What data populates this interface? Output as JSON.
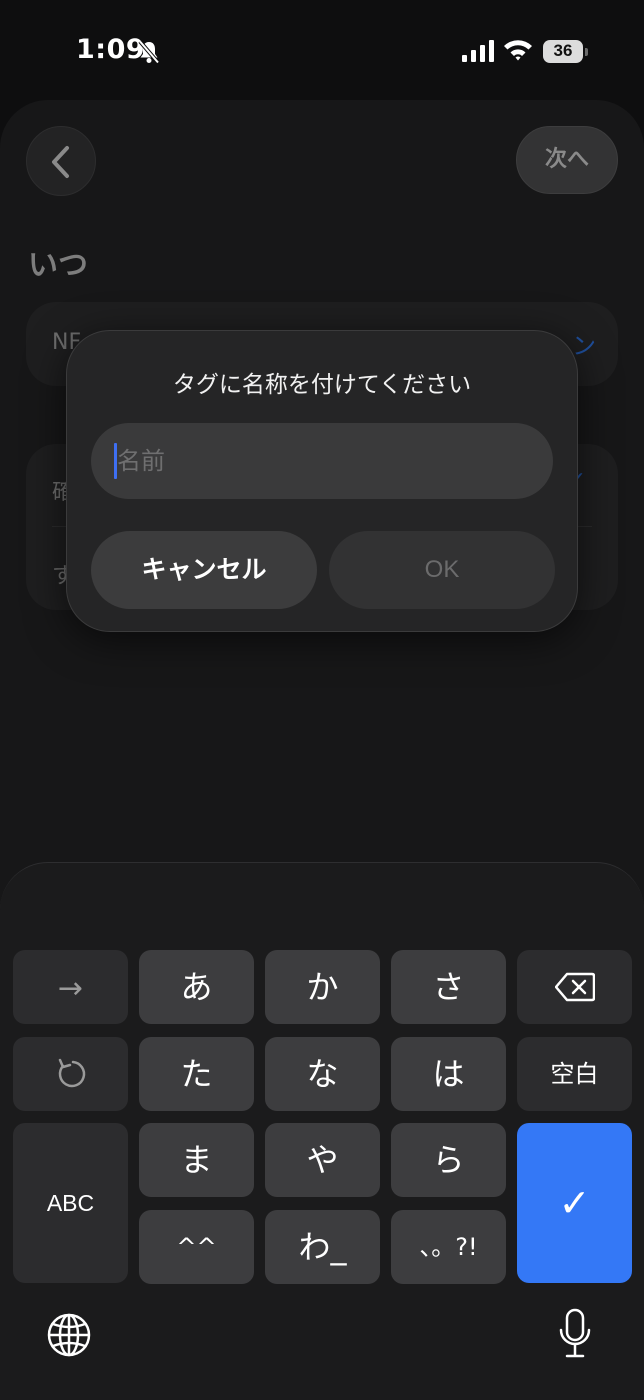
{
  "status_bar": {
    "time": "1:09",
    "battery": "36"
  },
  "header": {
    "back_icon": "chevron-left-icon",
    "next_label": "次へ"
  },
  "content": {
    "section_title": "いつ",
    "row1": {
      "label": "NF",
      "link": "ン"
    },
    "row2": {
      "label_a": "確",
      "check": "✓",
      "label_b": "す"
    }
  },
  "dialog": {
    "title": "タグに名称を付けてください",
    "input": {
      "value": "",
      "placeholder": "名前"
    },
    "cancel_label": "キャンセル",
    "ok_label": "OK"
  },
  "keyboard": {
    "arrow_key": "→",
    "row1": [
      "あ",
      "か",
      "さ"
    ],
    "row2": [
      "た",
      "な",
      "は"
    ],
    "space_label": "空白",
    "row3": [
      "ま",
      "や",
      "ら"
    ],
    "row4": [
      "^^",
      "わ_",
      "、。?!"
    ],
    "abc_label": "ABC",
    "enter_symbol": "✓",
    "accent_color": "#3478f6"
  }
}
